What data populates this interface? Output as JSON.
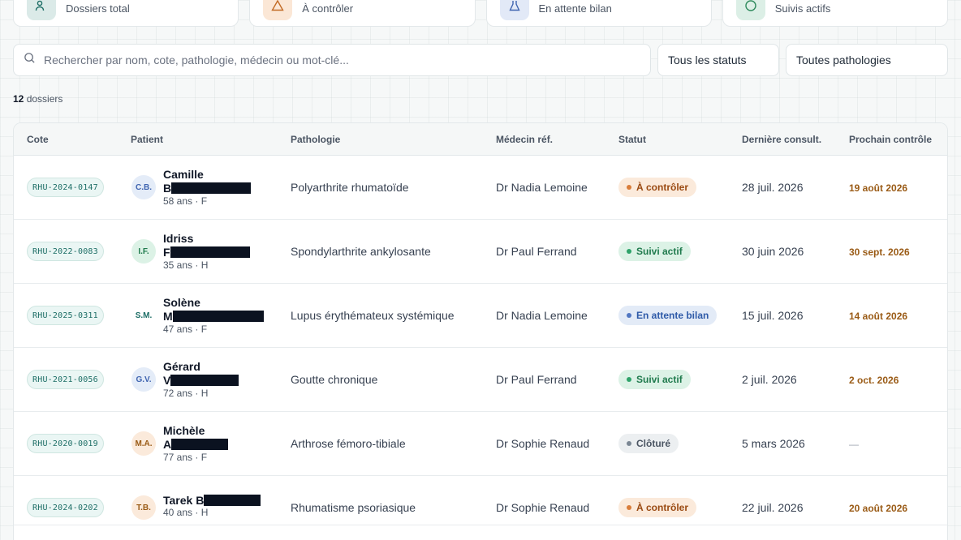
{
  "stats": [
    {
      "label": "Dossiers total",
      "icon": "users-icon",
      "color": "#dbeae8"
    },
    {
      "label": "À contrôler",
      "icon": "warning-icon",
      "color": "#fbe7d6"
    },
    {
      "label": "En attente bilan",
      "icon": "flask-icon",
      "color": "#e2e9f7"
    },
    {
      "label": "Suivis actifs",
      "icon": "check-circle-icon",
      "color": "#dcefe6"
    }
  ],
  "search": {
    "placeholder": "Rechercher par nom, cote, pathologie, médecin ou mot-clé..."
  },
  "filters": {
    "status": "Tous les statuts",
    "pathology": "Toutes pathologies"
  },
  "count": {
    "value": "12",
    "label": "dossiers"
  },
  "table": {
    "headers": [
      "Cote",
      "Patient",
      "Pathologie",
      "Médecin réf.",
      "Statut",
      "Dernière consult.",
      "Prochain contrôle"
    ],
    "rows": [
      {
        "cote": "RHU-2024-0147",
        "initials": "C.B.",
        "name_first": "Camille",
        "name_initial": "B",
        "meta": "58 ans · F",
        "pathology": "Polyarthrite rhumatoïde",
        "doctor": "Dr Nadia Lemoine",
        "status": "À contrôler",
        "status_kind": "warn",
        "last": "28 juil. 2026",
        "next": "19 août 2026",
        "avatar_kind": "blue"
      },
      {
        "cote": "RHU-2022-0083",
        "initials": "I.F.",
        "name_first": "Idriss",
        "name_initial": "F",
        "meta": "35 ans · H",
        "pathology": "Spondylarthrite ankylosante",
        "doctor": "Dr Paul Ferrand",
        "status": "Suivi actif",
        "status_kind": "ok",
        "last": "30 juin 2026",
        "next": "30 sept. 2026",
        "avatar_kind": "green"
      },
      {
        "cote": "RHU-2025-0311",
        "initials": "S.M.",
        "name_first": "Solène",
        "name_initial": "M",
        "meta": "47 ans · F",
        "pathology": "Lupus érythémateux systémique",
        "doctor": "Dr Nadia Lemoine",
        "status": "En attente bilan",
        "status_kind": "wait",
        "last": "15 juil. 2026",
        "next": "14 août 2026",
        "avatar_kind": "teal"
      },
      {
        "cote": "RHU-2021-0056",
        "initials": "G.V.",
        "name_first": "Gérard",
        "name_initial": "V",
        "meta": "72 ans · H",
        "pathology": "Goutte chronique",
        "doctor": "Dr Paul Ferrand",
        "status": "Suivi actif",
        "status_kind": "ok",
        "last": "2 juil. 2026",
        "next": "2 oct. 2026",
        "avatar_kind": "blue"
      },
      {
        "cote": "RHU-2020-0019",
        "initials": "M.A.",
        "name_first": "Michèle",
        "name_initial": "A",
        "meta": "77 ans · F",
        "pathology": "Arthrose fémoro-tibiale",
        "doctor": "Dr Sophie Renaud",
        "status": "Clôturé",
        "status_kind": "closed",
        "last": "5 mars 2026",
        "next": "—",
        "avatar_kind": "orange"
      },
      {
        "cote": "RHU-2024-0202",
        "initials": "T.B.",
        "name_first": "Tarek B",
        "name_initial": "",
        "meta": "40 ans · H",
        "pathology": "Rhumatisme psoriasique",
        "doctor": "Dr Sophie Renaud",
        "status": "À contrôler",
        "status_kind": "warn",
        "last": "22 juil. 2026",
        "next": "20 août 2026",
        "avatar_kind": "orange"
      }
    ]
  },
  "colors": {
    "warn_bg": "#fbeadb",
    "warn_fg": "#9a4a12",
    "warn_dot": "#d97d3a",
    "ok_bg": "#dcf2e6",
    "ok_fg": "#1f7a4d",
    "ok_dot": "#2ea36a",
    "wait_bg": "#e3ebf7",
    "wait_fg": "#2e5aa8",
    "wait_dot": "#5177c2",
    "closed_bg": "#eceff1",
    "closed_fg": "#4b5563",
    "closed_dot": "#7b8794"
  }
}
